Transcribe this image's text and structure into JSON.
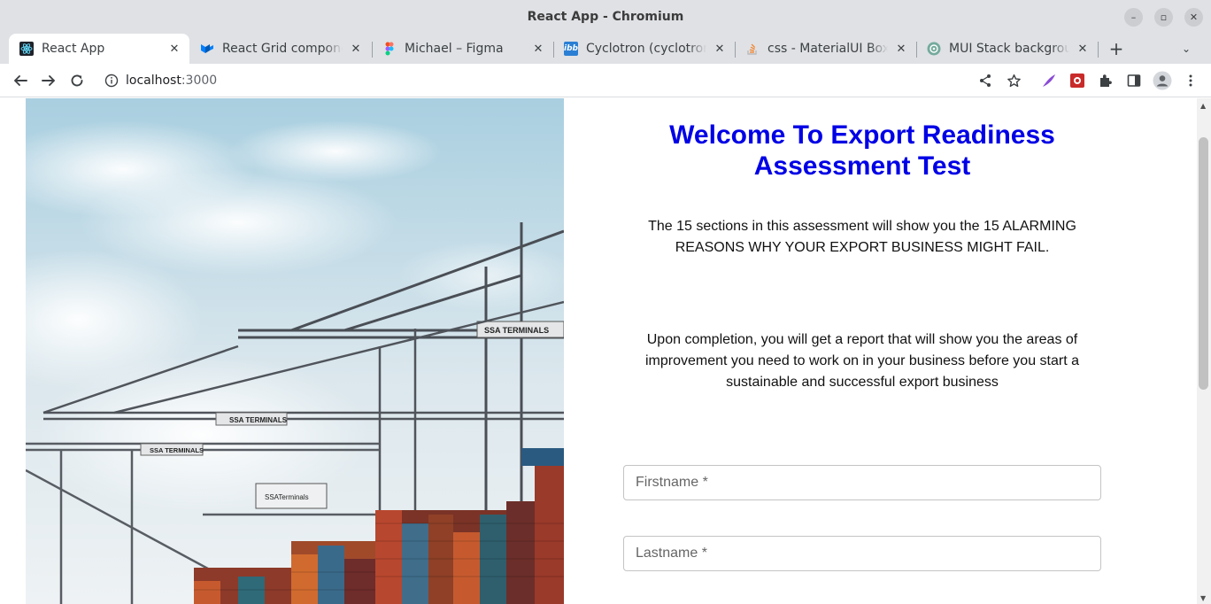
{
  "window": {
    "title": "React App - Chromium",
    "controls": {
      "minimize": "–",
      "maximize": "▫",
      "close": "✕"
    }
  },
  "tabs": [
    {
      "label": "React App",
      "favicon": "react-icon",
      "active": true
    },
    {
      "label": "React Grid component",
      "favicon": "mui-icon",
      "active": false
    },
    {
      "label": "Michael – Figma",
      "favicon": "figma-icon",
      "active": false
    },
    {
      "label": "Cyclotron (cyclotron)",
      "favicon": "ibb-icon",
      "active": false
    },
    {
      "label": "css - MaterialUI Box takes",
      "favicon": "stackoverflow-icon",
      "active": false
    },
    {
      "label": "MUI Stack background",
      "favicon": "chatgpt-icon",
      "active": false
    }
  ],
  "tab_close_glyph": "✕",
  "new_tab_glyph": "+",
  "tab_menu_glyph": "⌄",
  "toolbar": {
    "url_host": "localhost",
    "url_port": ":3000"
  },
  "page": {
    "heading": "Welcome To Export Readiness Assessment Test",
    "intro": "The 15 sections in this assessment will show you the 15 ALARMING REASONS WHY YOUR EXPORT BUSINESS MIGHT FAIL.",
    "completion": "Upon completion, you will get a report that will show you the areas of improvement you need to work on in your business before you start a sustainable and successful export business",
    "firstname_placeholder": "Firstname *",
    "lastname_placeholder": "Lastname *",
    "crane_label_1": "SSA TERMINALS",
    "crane_label_2": "SSA TERMINALS",
    "crane_label_3": "SSA TERMINALS",
    "crane_label_4": "SSATerminals"
  },
  "colors": {
    "heading": "#0000e6",
    "chrome_bg": "#dfe1e5",
    "sky": "#b9d7e6"
  }
}
